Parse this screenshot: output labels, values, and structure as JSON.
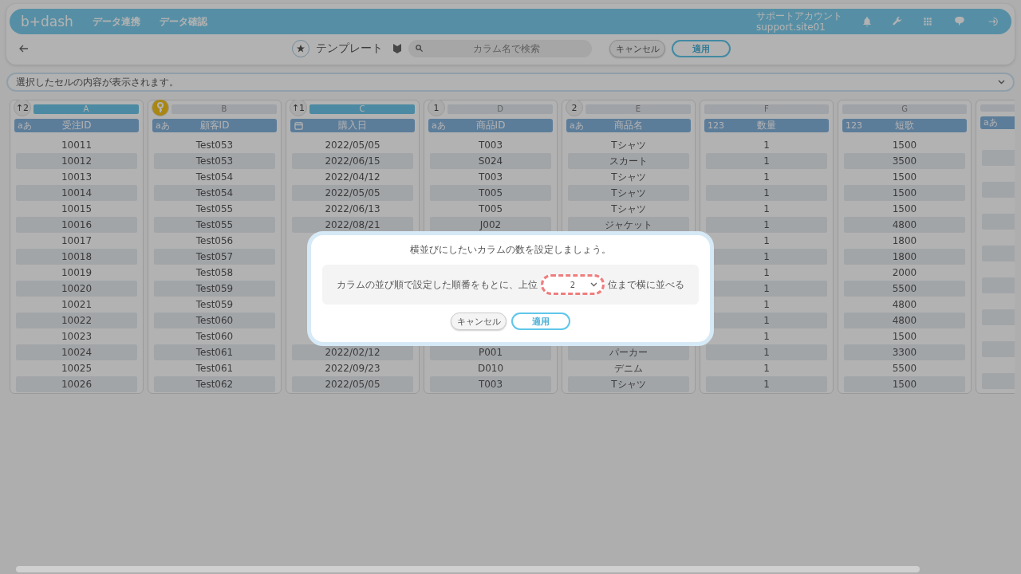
{
  "header": {
    "logo": "b+dash",
    "nav": [
      "データ連携",
      "データ確認"
    ],
    "account_name": "サポートアカウント",
    "account_id": "support.site01"
  },
  "toolbar": {
    "title": "テンプレート",
    "search": {
      "placeholder": "カラム名で検索"
    },
    "buttons": [
      {
        "label": "キャンセル",
        "kind": "secondary"
      },
      {
        "label": "適用",
        "kind": "primary"
      }
    ]
  },
  "info_bar": {
    "text": "選択したセルの内容が表示されます。"
  },
  "columns": [
    {
      "letter": "A",
      "selected": true,
      "badge": {
        "kind": "sort",
        "text": "↑2"
      },
      "kind": "text",
      "type_label": "aあ",
      "title": "受注ID",
      "cells": [
        "10011",
        "10012",
        "10013",
        "10014",
        "10015",
        "10016",
        "10017",
        "10018",
        "10019",
        "10020",
        "10021",
        "10022",
        "10023",
        "10024",
        "10025",
        "10026"
      ]
    },
    {
      "letter": "B",
      "selected": false,
      "badge": {
        "kind": "key"
      },
      "kind": "text",
      "type_label": "aあ",
      "title": "顧客ID",
      "cells": [
        "Test053",
        "Test053",
        "Test054",
        "Test054",
        "Test055",
        "Test055",
        "Test056",
        "Test057",
        "Test058",
        "Test059",
        "Test059",
        "Test060",
        "Test060",
        "Test061",
        "Test061",
        "Test062"
      ]
    },
    {
      "letter": "C",
      "selected": true,
      "badge": {
        "kind": "sort",
        "text": "↑1"
      },
      "kind": "date",
      "title": "購入日",
      "cells": [
        "2022/05/05",
        "2022/06/15",
        "2022/04/12",
        "2022/05/05",
        "2022/06/13",
        "2022/08/21",
        null,
        null,
        null,
        null,
        null,
        null,
        null,
        "2022/02/12",
        "2022/09/23",
        "2022/05/05"
      ]
    },
    {
      "letter": "D",
      "selected": false,
      "badge": {
        "kind": "order",
        "text": "1"
      },
      "kind": "text",
      "type_label": "aあ",
      "title": "商品ID",
      "cells": [
        "T003",
        "S024",
        "T003",
        "T005",
        "T005",
        "J002",
        null,
        null,
        null,
        null,
        null,
        null,
        null,
        "P001",
        "D010",
        "T003"
      ]
    },
    {
      "letter": "E",
      "selected": false,
      "badge": {
        "kind": "order",
        "text": "2"
      },
      "kind": "text",
      "type_label": "aあ",
      "title": "商品名",
      "cells": [
        "Tシャツ",
        "スカート",
        "Tシャツ",
        "Tシャツ",
        "Tシャツ",
        "ジャケット",
        null,
        null,
        null,
        null,
        null,
        null,
        null,
        "パーカー",
        "デニム",
        "Tシャツ"
      ]
    },
    {
      "letter": "F",
      "selected": false,
      "kind": "number",
      "type_label": "123",
      "title": "数量",
      "cells": [
        "1",
        "1",
        "1",
        "1",
        "1",
        "1",
        "1",
        "1",
        "1",
        "1",
        "1",
        "1",
        "1",
        "1",
        "1",
        "1"
      ]
    },
    {
      "letter": "G",
      "selected": false,
      "kind": "number",
      "type_label": "123",
      "title": "短歌",
      "cells": [
        "1500",
        "3500",
        "1500",
        "1500",
        "1500",
        "4800",
        "1800",
        "1800",
        "2000",
        "5500",
        "4800",
        "4800",
        "1500",
        "3300",
        "5500",
        "1500"
      ]
    },
    {
      "selected": false,
      "kind": "text",
      "type_label": "aあ"
    }
  ],
  "dialog": {
    "title": "横並びにしたいカラムの数を設定しましょう。",
    "prefix": "カラムの並び順で設定した順番をもとに、上位",
    "select": {
      "value": "2"
    },
    "suffix": "位まで横に並べる",
    "buttons": [
      {
        "label": "キャンセル",
        "kind": "secondary"
      },
      {
        "label": "適用",
        "kind": "primary"
      }
    ]
  }
}
